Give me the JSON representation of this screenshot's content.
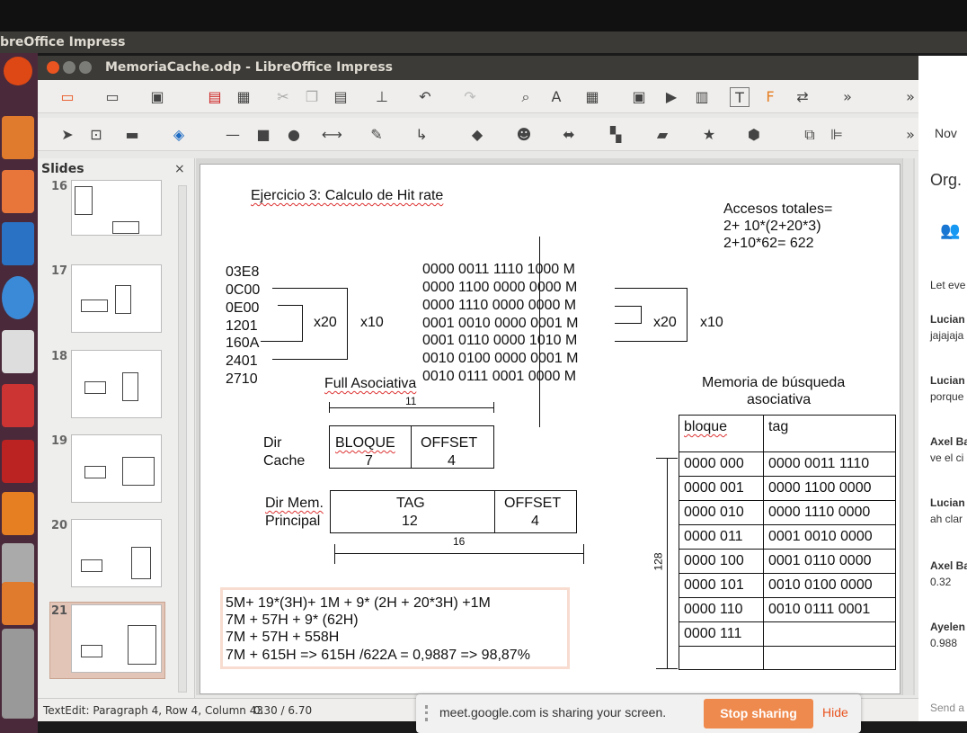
{
  "app": {
    "title": "breOffice Impress"
  },
  "window": {
    "title": "MemoriaCache.odp - LibreOffice Impress"
  },
  "slides_panel": {
    "title": "Slides",
    "close": "×",
    "numbers": [
      "16",
      "17",
      "18",
      "19",
      "20",
      "21"
    ]
  },
  "slide": {
    "title": "Ejercicio 3: Calculo de Hit rate",
    "accesos": [
      "Accesos totales=",
      "2+ 10*(2+20*3)",
      "2+10*62= 622"
    ],
    "addresses_hex": [
      "03E8",
      "0C00",
      "0E00",
      "1201",
      "160A",
      "2401",
      "2710"
    ],
    "addresses_bin": [
      "0000 0011 1110 1000 M",
      "0000 1100 0000 0000 M",
      "0000 1110 0000 0000 M",
      "0001 0010 0000 0001 M",
      "0001 0110 0000 1010 M",
      "0010 0100 0000 0001 M",
      "0010 0111 0001 0000 M"
    ],
    "loops": {
      "x20_left": "x20",
      "x10_left": "x10",
      "x20_right": "x20",
      "x10_right": "x10"
    },
    "full_asociativa": "Full Asociativa",
    "dim_11": "11",
    "dir_cache": {
      "label1": "Dir",
      "label2": "Cache",
      "bloque": "BLOQUE",
      "bloque_val": "7",
      "offset": "OFFSET",
      "offset_val": "4"
    },
    "dir_mem": {
      "label1": "Dir Mem.",
      "label2": "Principal",
      "tag": "TAG",
      "tag_val": "12",
      "offset": "OFFSET",
      "offset_val": "4"
    },
    "dim_16": "16",
    "memoria_title": [
      "Memoria de búsqueda",
      "asociativa"
    ],
    "table_headers": [
      "bloque",
      "tag"
    ],
    "table_rows": [
      [
        "0000 000",
        "0000 0011 1110"
      ],
      [
        "0000 001",
        "0000 1100 0000"
      ],
      [
        "0000 010",
        "0000 1110 0000"
      ],
      [
        "0000 011",
        "0001 0010 0000"
      ],
      [
        "0000 100",
        "0001 0110 0000"
      ],
      [
        "0000 101",
        "0010 0100 0000"
      ],
      [
        "0000 110",
        "0010 0111 0001"
      ],
      [
        "0000 111",
        ""
      ],
      [
        "",
        ""
      ]
    ],
    "dim_128": "128",
    "calc": [
      "5M+ 19*(3H)+ 1M + 9* (2H + 20*3H) +1M",
      "7M + 57H + 9* (62H)",
      "7M + 57H + 558H",
      "7M + 615H => 615H /622A = 0,9887 => 98,87%"
    ]
  },
  "status": {
    "text": "TextEdit: Paragraph 4, Row 4, Column 43",
    "pos": "0.30 / 6.70"
  },
  "meet": {
    "text": "meet.google.com is sharing your screen.",
    "stop": "Stop sharing",
    "hide": "Hide"
  },
  "right_panel": {
    "nov": "Nov",
    "org": "Org.",
    "let": "Let eve",
    "msgs": [
      {
        "name": "Lucian",
        "text": "jajajaja"
      },
      {
        "name": "Lucian",
        "text": "porque"
      },
      {
        "name": "Axel Ba",
        "text": "ve el ci"
      },
      {
        "name": "Lucian",
        "text": "ah clar"
      },
      {
        "name": "Axel Ba",
        "text": "0.32"
      },
      {
        "name": "Ayelen",
        "text": "0.988"
      }
    ],
    "send": "Send a"
  },
  "colors": {
    "accent": "#e95420",
    "stop": "#ef8a4e",
    "launcher": "#4a2a3a"
  }
}
